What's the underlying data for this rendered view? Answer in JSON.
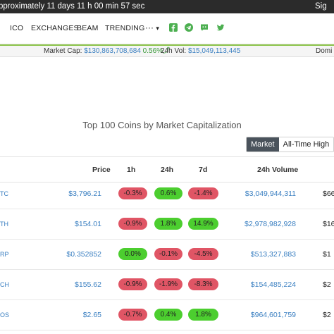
{
  "topbar": {
    "countdown_text": "pproximately 11 days 11 h 00 min 57 sec",
    "signin_label": "Sig"
  },
  "nav": {
    "items": [
      "ICO",
      "EXCHANGES",
      "BEAM",
      "TRENDING"
    ],
    "more_label": "···",
    "more_caret": "▾",
    "social_icons": [
      "facebook-icon",
      "telegram-icon",
      "discord-icon",
      "twitter-icon"
    ],
    "social_color": "#4caf50"
  },
  "stats": {
    "market_cap_label": "Market Cap:",
    "market_cap_value": "$130,863,708,684",
    "market_cap_change": "0.56%",
    "market_cap_arrow": "⤴",
    "vol_label": "24h Vol:",
    "vol_value": "$15,049,113,445",
    "dominance_label": "Domi"
  },
  "heading": "Top 100 Coins by Market Capitalization",
  "toggle": {
    "market_label": "Market",
    "ath_label": "All-Time High"
  },
  "table": {
    "headers": {
      "price": "Price",
      "h1": "1h",
      "h24": "24h",
      "d7": "7d",
      "volume": "24h Volume"
    },
    "rows": [
      {
        "sym": "TC",
        "price": "$3,796.21",
        "h1": "-0.3%",
        "h24": "0.6%",
        "d7": "-1.4%",
        "volume": "$3,049,944,311",
        "cap": "$66",
        "h1_pos": false,
        "h24_pos": true,
        "d7_pos": false
      },
      {
        "sym": "TH",
        "price": "$154.01",
        "h1": "-0.9%",
        "h24": "1.8%",
        "d7": "14.9%",
        "volume": "$2,978,982,928",
        "cap": "$16",
        "h1_pos": false,
        "h24_pos": true,
        "d7_pos": true
      },
      {
        "sym": "RP",
        "price": "$0.352852",
        "h1": "0.0%",
        "h24": "-0.1%",
        "d7": "-4.5%",
        "volume": "$513,327,883",
        "cap": "$1",
        "h1_pos": true,
        "h24_pos": false,
        "d7_pos": false
      },
      {
        "sym": "CH",
        "price": "$155.62",
        "h1": "-0.9%",
        "h24": "-1.9%",
        "d7": "-8.3%",
        "volume": "$154,485,224",
        "cap": "$2",
        "h1_pos": false,
        "h24_pos": false,
        "d7_pos": false
      },
      {
        "sym": "OS",
        "price": "$2.65",
        "h1": "-0.7%",
        "h24": "0.4%",
        "d7": "1.8%",
        "volume": "$964,601,759",
        "cap": "$2",
        "h1_pos": false,
        "h24_pos": true,
        "d7_pos": true
      }
    ]
  },
  "colors": {
    "positive": "#4cce2f",
    "negative": "#e05565",
    "link": "#3a7fc1",
    "accent_bar": "#8bc34a"
  }
}
